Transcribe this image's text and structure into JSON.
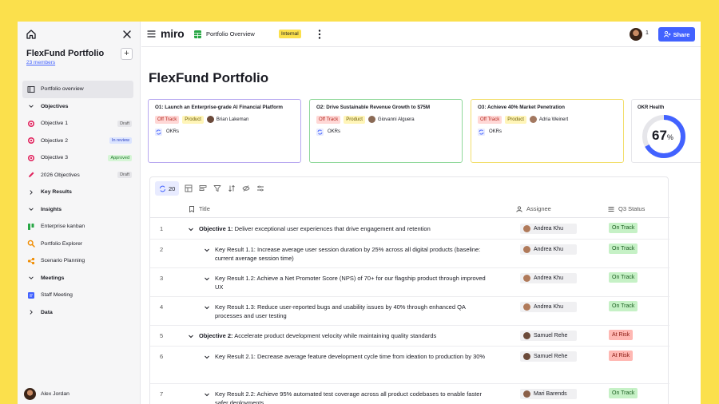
{
  "sidebar": {
    "title": "FlexFund Portfolio",
    "members": "23 members",
    "add_label": "+",
    "items": [
      {
        "label": "Portfolio overview",
        "icon": "board-icon",
        "kind": "item"
      },
      {
        "label": "Objectives",
        "kind": "section"
      },
      {
        "label": "Objective 1",
        "badge": "Draft",
        "badge_kind": "draft",
        "icon": "target-icon",
        "kind": "item"
      },
      {
        "label": "Objective 2",
        "badge": "In review",
        "badge_kind": "review",
        "icon": "target-icon",
        "kind": "item"
      },
      {
        "label": "Objective 3",
        "badge": "Approved",
        "badge_kind": "approved",
        "icon": "target-icon",
        "kind": "item"
      },
      {
        "label": "2026 Objectives",
        "badge": "Draft",
        "badge_kind": "draft",
        "icon": "pen-icon",
        "kind": "item"
      },
      {
        "label": "Key Results",
        "kind": "section"
      },
      {
        "label": "Insights",
        "kind": "section"
      },
      {
        "label": "Enterprise kanban",
        "icon": "kanban-icon",
        "kind": "item"
      },
      {
        "label": "Portfolio Explorer",
        "icon": "explorer-icon",
        "kind": "item"
      },
      {
        "label": "Scenario Planning",
        "icon": "scenario-icon",
        "kind": "item"
      },
      {
        "label": "Meetings",
        "kind": "section"
      },
      {
        "label": "Staff Meeting",
        "icon": "meeting-icon",
        "kind": "item"
      },
      {
        "label": "Data",
        "kind": "section"
      }
    ],
    "user": "Alex Jordan"
  },
  "topbar": {
    "logo": "miro",
    "board_name": "Portfolio Overview",
    "tag": "Internal",
    "viewer_count": "1",
    "share_label": "Share"
  },
  "main": {
    "title": "FlexFund Portfolio",
    "objectives": [
      {
        "title": "O1: Launch an Enterprise-grade AI Financial Platform",
        "status": "Off Track",
        "category": "Product",
        "owner": "Brian Lakeman",
        "link": "OKRs"
      },
      {
        "title": "O2: Drive Sustainable Revenue Growth to $75M",
        "status": "Off Track",
        "category": "Product",
        "owner": "Giovanni Alguera",
        "link": "OKRs"
      },
      {
        "title": "O3: Achieve 40% Market Penetration",
        "status": "Off Track",
        "category": "Product",
        "owner": "Adria Weinert",
        "link": "OKRs"
      }
    ],
    "health": {
      "label": "OKR Health",
      "value": "67",
      "unit": "%",
      "fraction": 0.67
    },
    "table": {
      "count": "20",
      "columns": {
        "title": "Title",
        "assignee": "Assignee",
        "status": "Q3 Status"
      },
      "rows": [
        {
          "num": "1",
          "prefix": "Objective 1:",
          "text": " Deliver exceptional user experiences that drive engagement and retention",
          "assignee": "Andrea Khu",
          "status": "On Track"
        },
        {
          "num": "2",
          "prefix": "",
          "text": "Key Result 1.1: Increase average user session duration by 25% across all digital products (baseline: current average session time)",
          "assignee": "Andrea Khu",
          "status": "On Track"
        },
        {
          "num": "3",
          "prefix": "",
          "text": "Key Result 1.2: Achieve a Net Promoter Score (NPS) of 70+ for our flagship product through improved UX",
          "assignee": "Andrea Khu",
          "status": "On Track"
        },
        {
          "num": "4",
          "prefix": "",
          "text": "Key Result 1.3: Reduce user-reported bugs and usability issues by 40% through enhanced QA processes and user testing",
          "assignee": "Andrea Khu",
          "status": "On Track"
        },
        {
          "num": "5",
          "prefix": "Objective 2:",
          "text": " Accelerate product development velocity while maintaining quality standards",
          "assignee": "Samuel Rehe",
          "status": "At Risk"
        },
        {
          "num": "6",
          "prefix": "",
          "text": "Key Result 2.1: Decrease average feature development cycle time from ideation to production by 30%",
          "assignee": "Samuel Rehe",
          "status": "At Risk"
        },
        {
          "num": "7",
          "prefix": "",
          "text": "Key Result 2.2: Achieve 95% automated test coverage across all product codebases to enable faster safer deployments",
          "assignee": "Mari Barends",
          "status": "On Track"
        }
      ]
    }
  }
}
